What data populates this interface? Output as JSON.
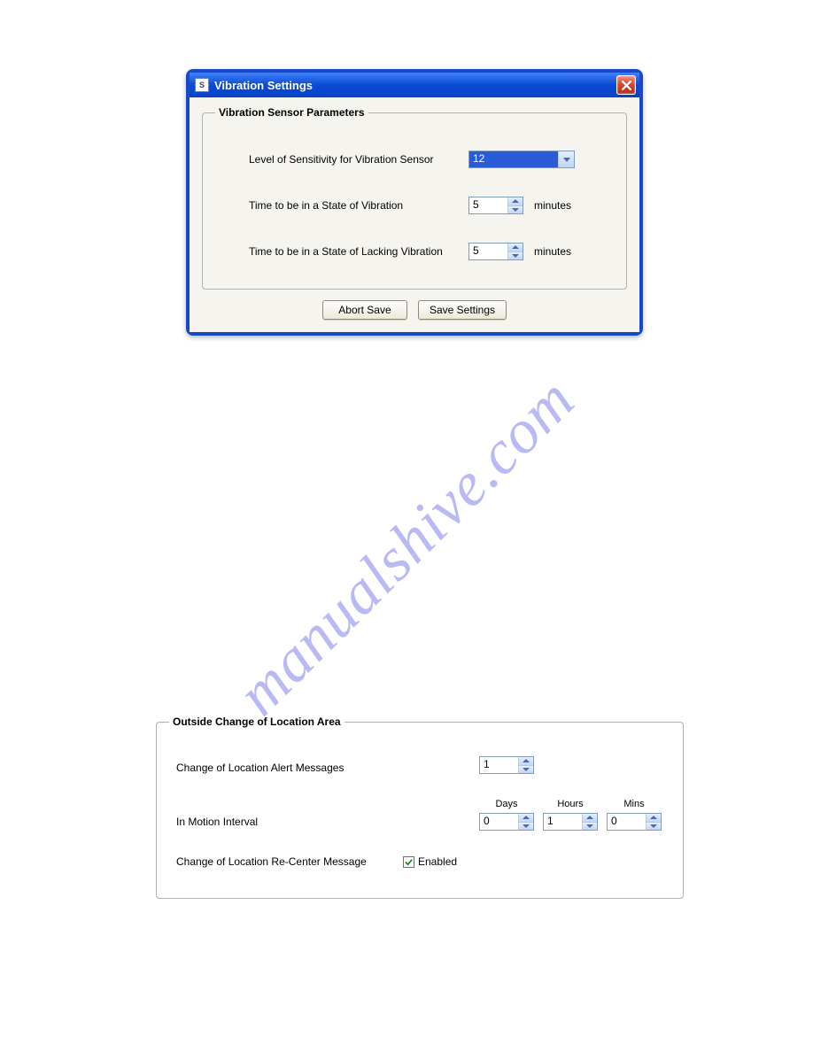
{
  "watermark_text": "manualshive.com",
  "dialog": {
    "title": "Vibration Settings",
    "legend": "Vibration Sensor Parameters",
    "row_sensitivity": {
      "label": "Level of Sensitivity for Vibration Sensor",
      "value": "12"
    },
    "row_state_vib": {
      "label": "Time to be in a State of Vibration",
      "value": "5",
      "unit": "minutes"
    },
    "row_state_novib": {
      "label": "Time to be in a State of Lacking Vibration",
      "value": "5",
      "unit": "minutes"
    },
    "buttons": {
      "abort": "Abort Save",
      "save": "Save Settings"
    }
  },
  "lower": {
    "legend": "Outside Change of Location Area",
    "row_alert": {
      "label": "Change of Location Alert Messages",
      "value": "1"
    },
    "row_motion": {
      "label": "In Motion Interval",
      "headers": {
        "days": "Days",
        "hours": "Hours",
        "mins": "Mins"
      },
      "values": {
        "days": "0",
        "hours": "1",
        "mins": "0"
      }
    },
    "row_recenter": {
      "label": "Change of Location Re-Center Message",
      "enabled_label": "Enabled",
      "checked": true
    }
  }
}
